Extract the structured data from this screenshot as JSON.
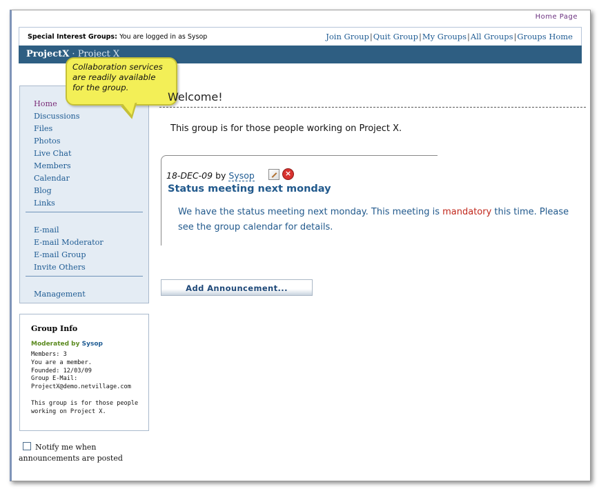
{
  "header": {
    "home_link": "Home Page",
    "sig_label": "Special Interest Groups:",
    "login_status": "You are logged in as Sysop",
    "nav": [
      "Join Group",
      "Quit Group",
      "My Groups",
      "All Groups",
      "Groups Home"
    ]
  },
  "titlebar": {
    "project": "ProjectX",
    "separator": " · ",
    "subtitle": "Project X"
  },
  "callout": {
    "line1": "Collaboration services",
    "line2": "are readily available",
    "line3": "for the group."
  },
  "sidebar": {
    "items": [
      "Home",
      "Discussions",
      "Files",
      "Photos",
      "Live Chat",
      "Members",
      "Calendar",
      "Blog",
      "Links"
    ],
    "email_items": [
      "E-mail",
      "E-mail Moderator",
      "E-mail Group",
      "Invite Others"
    ],
    "admin_items": [
      "Management"
    ]
  },
  "group_info": {
    "heading": "Group Info",
    "moderated_label": "Moderated by",
    "moderator": "Sysop",
    "lines": [
      "Members: 3",
      "You are a member.",
      "Founded: 12/03/09",
      "Group E-Mail:",
      "ProjectX@demo.netvillage.com",
      "",
      "This group is for those people",
      "working on Project X."
    ]
  },
  "notify": {
    "label": "Notify me when announcements are posted",
    "checked": false
  },
  "main": {
    "welcome": "Welcome!",
    "intro": "This group is for those people working on Project X.",
    "announcement": {
      "date": "18-DEC-09",
      "by": "by",
      "author": "Sysop",
      "title": "Status meeting next monday",
      "body_before": "We have the status meeting next monday. This meeting is ",
      "body_highlight": "mandatory",
      "body_after": " this time. Please see the group calendar for details."
    },
    "add_button": "Add Announcement..."
  },
  "colors": {
    "link": "#1e5b93",
    "titlebar": "#2e5e82",
    "highlight": "#c1271b",
    "callout": "#f3ef57"
  }
}
